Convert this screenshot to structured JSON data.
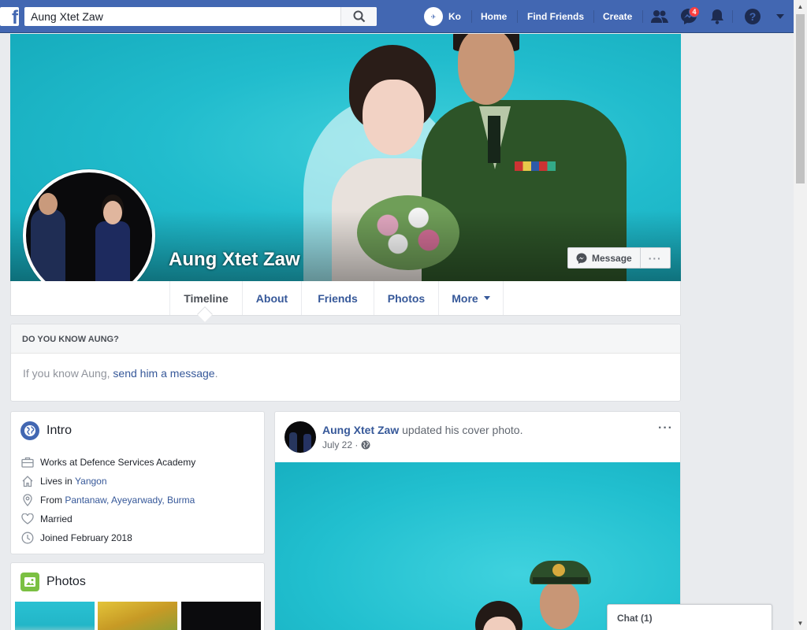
{
  "header": {
    "search_value": "Aung Xtet Zaw",
    "user_name": "Ko",
    "nav_home": "Home",
    "nav_find_friends": "Find Friends",
    "nav_create": "Create",
    "messages_badge": "4",
    "brand_color": "#4267b2"
  },
  "profile": {
    "name": "Aung Xtet Zaw",
    "message_button": "Message",
    "more_button": "···"
  },
  "tabs": [
    {
      "label": "Timeline"
    },
    {
      "label": "About"
    },
    {
      "label": "Friends"
    },
    {
      "label": "Photos"
    },
    {
      "label": "More"
    }
  ],
  "know_box": {
    "title": "DO YOU KNOW AUNG?",
    "text_prefix": "If you know Aung, ",
    "link": "send him a message",
    "text_suffix": "."
  },
  "intro": {
    "title": "Intro",
    "work": "Works at Defence Services Academy",
    "lives_prefix": "Lives in ",
    "lives_link": "Yangon",
    "from_prefix": "From ",
    "from_link": "Pantanaw, Ayeyarwady, Burma",
    "relationship": "Married",
    "joined": "Joined February 2018"
  },
  "photos_card": {
    "title": "Photos"
  },
  "post": {
    "author": "Aung Xtet Zaw",
    "action": " updated his cover photo.",
    "date": "July 22",
    "separator": "·",
    "menu": "···"
  },
  "chat": {
    "label": "Chat (1)"
  }
}
